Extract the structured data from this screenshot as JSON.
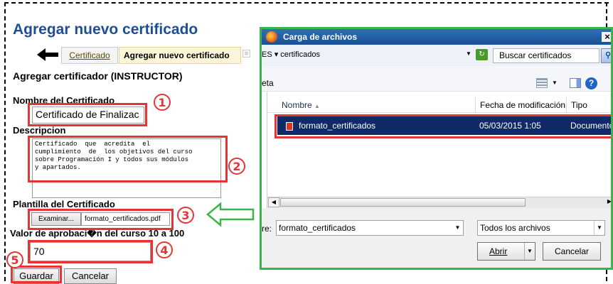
{
  "page": {
    "title": "Agregar nuevo certificado",
    "section_title": "Agregar certificador (INSTRUCTOR)"
  },
  "breadcrumb": {
    "back_icon": "back-arrow-icon",
    "tab_certificado": "Certificado",
    "tab_new": "Agregar nuevo certificado"
  },
  "form": {
    "name_label": "Nombre del Certificado",
    "name_value": "Certificado de Finalizac",
    "description_label": "Descripcion",
    "description_value": "Certificado  que  acredita  el\ncumplimiento  de  los objetivos del curso\nsobre Programación I y todos sus módulos\ny apartados.",
    "template_label": "Plantilla del Certificado",
    "browse_label": "Examinar...",
    "template_file": "formato_certificados.pdf",
    "approval_label": "Valor de aprobaci�n del curso 10 a 100",
    "approval_value": "70",
    "save_label": "Guardar",
    "cancel_label": "Cancelar"
  },
  "annotations": {
    "color": "#e53434",
    "arrow_color": "#3ab54a",
    "steps": [
      "1",
      "2",
      "3",
      "4",
      "5"
    ]
  },
  "dialog": {
    "title": "Carga de archivos",
    "close_label": "×",
    "path": "ES ▾ certificados",
    "search_placeholder": "Buscar certificados",
    "organize_label": "eta",
    "columns": {
      "name": "Nombre",
      "date": "Fecha de modificación",
      "type": "Tipo"
    },
    "file": {
      "name": "formato_certificados",
      "date": "05/03/2015 1:05",
      "type": "Documento"
    },
    "filename_label": "re:",
    "filename_value": "formato_certificados",
    "filetype_value": "Todos los archivos",
    "open_label": "Abrir",
    "cancel_label": "Cancelar",
    "border_color": "#3ab54a"
  }
}
